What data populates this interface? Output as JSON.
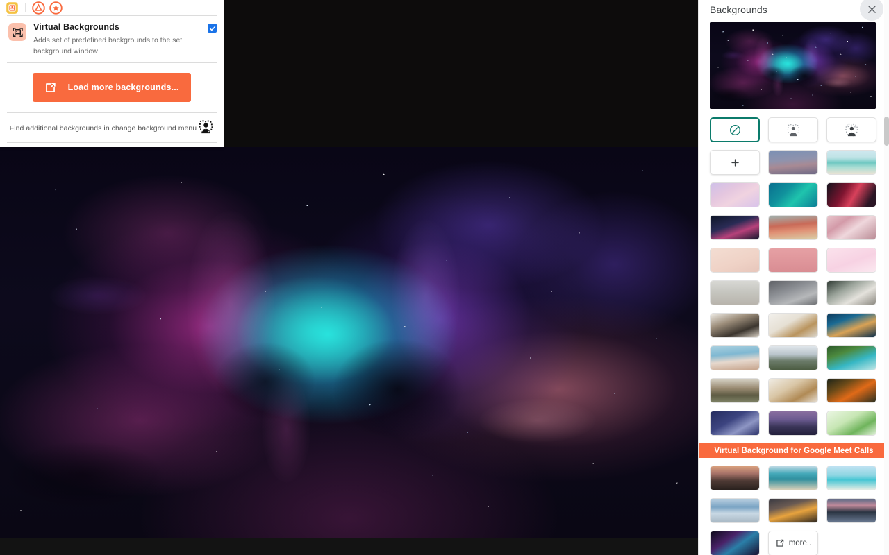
{
  "extension_panel": {
    "toolbar_icons": [
      "extension-puzzle-icon",
      "drive-triangle-icon",
      "star-circle-icon"
    ],
    "feature": {
      "icon": "virtual-backgrounds-image-icon",
      "title": "Virtual Backgrounds",
      "description": "Adds set of predefined backgrounds to the set background window",
      "enabled": true,
      "checkbox_color": "#1a73e8"
    },
    "load_more_button": {
      "label": "Load more backgrounds...",
      "icon": "external-link-icon",
      "color": "#f96a3e"
    },
    "footer": {
      "text": "Find additional backgrounds in change background menu",
      "icon": "person-blur-icon"
    }
  },
  "backgrounds_panel": {
    "title": "Backgrounds",
    "close_icon": "close-icon",
    "preview": {
      "name": "nebula-space-preview",
      "alt": "Purple and blue nebula galaxy"
    },
    "effect_buttons": [
      {
        "name": "no-background",
        "icon": "no-effect-slash-icon",
        "selected": true,
        "selected_color": "#0b7b6b"
      },
      {
        "name": "blur-slight",
        "icon": "slight-blur-person-icon",
        "selected": false
      },
      {
        "name": "blur-full",
        "icon": "full-blur-person-icon",
        "selected": false
      }
    ],
    "upload_button": {
      "name": "upload-background",
      "icon": "plus-icon",
      "label": "+"
    },
    "thumbnails": [
      {
        "id": "t01",
        "name": "gradient-dusk",
        "css": "linear-gradient(175deg,#7b90b4 0%,#8f93ad 40%,#a88a94 62%,#6f6a86 100%)"
      },
      {
        "id": "t02",
        "name": "turquoise-beach",
        "css": "linear-gradient(180deg,#cfe8ef 0%,#bfe3e6 30%,#6fc8c2 52%,#a8ddd4 70%,#e7e2d4 100%)"
      },
      {
        "id": "t03",
        "name": "pastel-clouds",
        "css": "linear-gradient(150deg,#cfc0e8 0%,#e4c6df 35%,#f0d3e0 60%,#d8c3ea 100%)"
      },
      {
        "id": "t04",
        "name": "teal-waves",
        "css": "linear-gradient(135deg,#0a6f8f 0%,#10919c 35%,#1fc4ad 60%,#0c7d95 100%)"
      },
      {
        "id": "t05",
        "name": "red-nebula",
        "css": "linear-gradient(120deg,#14121c 0%,#7e1530 35%,#d8415b 55%,#2a1524 85%)"
      },
      {
        "id": "t06",
        "name": "pink-fireworks",
        "css": "linear-gradient(160deg,#0d1526 0%,#2a2b55 40%,#b7417a 65%,#12172c 100%)"
      },
      {
        "id": "t07",
        "name": "coral-flowers",
        "css": "linear-gradient(175deg,#9fb3b0 0%,#c96a58 40%,#e08f74 62%,#d9cfa8 100%)"
      },
      {
        "id": "t08",
        "name": "cherry-blossom-bokeh",
        "css": "linear-gradient(145deg,#e8c6cc 0%,#d39aa8 30%,#efd7dc 55%,#b98b95 100%)"
      },
      {
        "id": "t09",
        "name": "blush-confetti",
        "css": "linear-gradient(160deg,#f3ddd2 0%,#efd2c6 60%,#e7c6bb 100%)"
      },
      {
        "id": "t10",
        "name": "pink-grid",
        "css": "linear-gradient(180deg,#e6a0a4 0%,#d98d93 100%)"
      },
      {
        "id": "t11",
        "name": "pink-sprinkles",
        "css": "linear-gradient(160deg,#fbe2ec 0%,#f7d2e3 55%,#fbe8f0 100%)"
      },
      {
        "id": "t12",
        "name": "bright-office",
        "css": "linear-gradient(180deg,#d8d8d4 0%,#c6c6c0 45%,#b8b4ac 100%)"
      },
      {
        "id": "t13",
        "name": "industrial-loft",
        "css": "linear-gradient(160deg,#5f6166 0%,#8d9095 40%,#b6b8ba 70%,#6e7074 100%)"
      },
      {
        "id": "t14",
        "name": "modern-living-room",
        "css": "linear-gradient(150deg,#2f3a33 0%,#9aa39a 35%,#e4e2dc 65%,#8d8a82 100%)"
      },
      {
        "id": "t15",
        "name": "bookshelf-study",
        "css": "linear-gradient(160deg,#efece6 0%,#9e8f7c 35%,#3b352e 70%,#d6cec2 100%)"
      },
      {
        "id": "t16",
        "name": "minimal-shelf",
        "css": "linear-gradient(150deg,#f2f0ec 0%,#e6e0d4 40%,#b9945e 70%,#dcd8d0 100%)"
      },
      {
        "id": "t17",
        "name": "outdoor-cafe-night",
        "css": "linear-gradient(160deg,#0e3a5c 0%,#1a6a93 30%,#d9a255 60%,#0d2f4a 100%)"
      },
      {
        "id": "t18",
        "name": "seaside-arch",
        "css": "linear-gradient(175deg,#a9d0df 0%,#7fb8d2 35%,#e6d8cd 62%,#c6a48c 100%)"
      },
      {
        "id": "t19",
        "name": "snowy-mountains",
        "css": "linear-gradient(180deg,#dfe5ea 0%,#b9c4cb 35%,#6c7c6a 62%,#4c5c42 100%)"
      },
      {
        "id": "t20",
        "name": "tropical-beach",
        "css": "linear-gradient(160deg,#2d5a2a 0%,#4c8a3e 30%,#36b7c4 62%,#bfe6e6 100%)"
      },
      {
        "id": "t21",
        "name": "horses-field",
        "css": "linear-gradient(180deg,#d6d2c6 0%,#9a8b72 40%,#5e5b44 70%,#7f8366 100%)"
      },
      {
        "id": "t22",
        "name": "warm-interior",
        "css": "linear-gradient(150deg,#f0ece4 0%,#d9c6a6 40%,#b08a55 70%,#e8e2d8 100%)"
      },
      {
        "id": "t23",
        "name": "autumn-leaves",
        "css": "linear-gradient(150deg,#1d2418 0%,#6b4a18 30%,#e06a18 58%,#2a3020 100%)"
      },
      {
        "id": "t24",
        "name": "blue-ferns",
        "css": "linear-gradient(150deg,#252c5e 0%,#3c4480 40%,#8e96c4 68%,#2a3068 100%)"
      },
      {
        "id": "t25",
        "name": "city-skyline-dusk",
        "css": "linear-gradient(180deg,#8a6fa0 0%,#6b5a90 35%,#3a3558 65%,#23203c 100%)"
      },
      {
        "id": "t26",
        "name": "green-leaves-pattern",
        "css": "linear-gradient(150deg,#eaf6e2 0%,#c7e6b4 40%,#6fb45c 70%,#e2f2da 100%)"
      },
      {
        "id": "t27",
        "name": "sunset-boardwalk",
        "css": "linear-gradient(180deg,#d9a07e 0%,#a9746a 30%,#4e3a34 62%,#2a211e 100%)"
      },
      {
        "id": "t28",
        "name": "turquoise-shallows",
        "css": "linear-gradient(180deg,#bcd9e4 0%,#43a8b8 32%,#2f8f9e 55%,#d8cfb8 100%)"
      },
      {
        "id": "t29",
        "name": "tropical-island",
        "css": "linear-gradient(180deg,#bfe2f2 0%,#8ed6e2 38%,#46c6d4 58%,#e4ece4 100%)"
      },
      {
        "id": "t30",
        "name": "ocean-waves",
        "css": "linear-gradient(180deg,#b9cfe0 0%,#7ba4c4 35%,#c8d8e4 62%,#a8b8c4 100%)"
      },
      {
        "id": "t31",
        "name": "dramatic-sunset",
        "css": "linear-gradient(165deg,#3a3a42 0%,#6a5a52 32%,#e8a33e 58%,#2c2620 100%)"
      },
      {
        "id": "t32",
        "name": "lake-reflection",
        "css": "linear-gradient(180deg,#5a6a86 0%,#c08a9a 28%,#2a3442 56%,#6a7a92 100%)"
      },
      {
        "id": "t33",
        "name": "purple-nebula",
        "css": "linear-gradient(145deg,#0d0a1a 0%,#4a2268 35%,#2a7fa8 58%,#1a1030 100%)"
      }
    ],
    "promo_banner": {
      "text": "Virtual Background for Google Meet Calls",
      "color": "#f96a3e"
    },
    "more_button": {
      "label": "more..",
      "icon": "external-link-icon"
    }
  }
}
